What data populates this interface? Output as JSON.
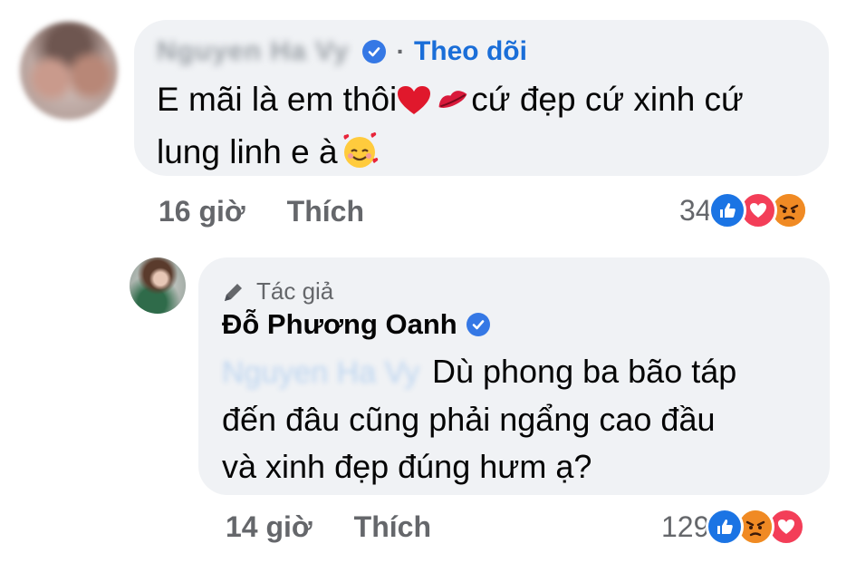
{
  "comment1": {
    "follow_label": "Theo dõi",
    "text_part1": "E mãi là em thôi",
    "text_part2": "cứ đẹp cứ xinh cứ",
    "text_line2": "lung linh e à",
    "time": "16 giờ",
    "like_label": "Thích",
    "reaction_count": "34",
    "reactions": [
      "like-icon",
      "love-icon",
      "angry-icon"
    ]
  },
  "comment2": {
    "author_tag": "Tác giả",
    "author_name": "Đỗ Phương Oanh",
    "text_line1": "Dù phong ba bão táp",
    "text_line2": "đến đâu cũng phải ngẩng cao đầu",
    "text_line3": "và xinh đẹp đúng hưm ạ?",
    "time": "14 giờ",
    "like_label": "Thích",
    "reaction_count": "129",
    "reactions": [
      "like-icon",
      "angry-icon",
      "love-icon"
    ]
  },
  "colors": {
    "bubble": "#f0f2f5",
    "link_blue": "#1a6ed8",
    "meta_gray": "#65676b",
    "like_blue": "#1b74e4",
    "love_red": "#f33e58",
    "angry_orange": "#f7b125"
  }
}
